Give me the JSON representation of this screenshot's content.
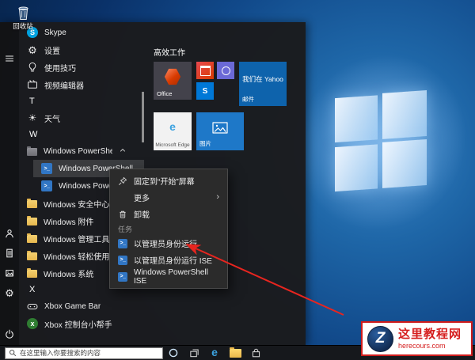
{
  "desktop": {
    "recycle_bin": {
      "label": "回收站",
      "icon": "recycle-bin"
    }
  },
  "start_menu": {
    "rail_icons": [
      "menu",
      "user",
      "documents",
      "pictures",
      "settings",
      "power"
    ],
    "app_list": [
      {
        "type": "app",
        "label": "Skype",
        "icon": "skype"
      },
      {
        "type": "app",
        "label": "设置",
        "icon": "settings-gear"
      },
      {
        "type": "app",
        "label": "使用技巧",
        "icon": "tips-bulb"
      },
      {
        "type": "app",
        "label": "视频编辑器",
        "icon": "video-editor"
      },
      {
        "type": "section",
        "label": "T"
      },
      {
        "type": "app",
        "label": "天气",
        "icon": "weather-sun"
      },
      {
        "type": "section",
        "label": "W"
      },
      {
        "type": "group",
        "label": "Windows PowerShell",
        "icon": "app-folder",
        "expanded": true
      },
      {
        "type": "app",
        "label": "Windows PowerShell",
        "icon": "powershell",
        "indent": true,
        "selected": true
      },
      {
        "type": "app",
        "label": "Windows PowerShell",
        "icon": "powershell",
        "indent": true
      },
      {
        "type": "folder",
        "label": "Windows 安全中心",
        "icon": "folder"
      },
      {
        "type": "folder",
        "label": "Windows 附件",
        "icon": "folder"
      },
      {
        "type": "folder",
        "label": "Windows 管理工具",
        "icon": "folder"
      },
      {
        "type": "folder",
        "label": "Windows 轻松使用",
        "icon": "folder"
      },
      {
        "type": "folder",
        "label": "Windows 系统",
        "icon": "folder"
      },
      {
        "type": "section",
        "label": "X"
      },
      {
        "type": "app",
        "label": "Xbox Game Bar",
        "icon": "xbox-gamebar"
      },
      {
        "type": "app",
        "label": "Xbox 控制台小帮手",
        "icon": "xbox-console"
      }
    ],
    "tiles": {
      "group_title": "高效工作",
      "office_label": "Office",
      "small_tiles": [
        {
          "icon": "calendar"
        },
        {
          "icon": "people"
        },
        {
          "icon": "skype"
        }
      ],
      "mail_promo": "我们在 Yahoo",
      "mail_label": "邮件",
      "edge_label": "Microsoft Edge",
      "photos_label": "图片"
    }
  },
  "context_menu": {
    "items": [
      {
        "label": "固定到“开始”屏幕",
        "icon": "pin"
      },
      {
        "label": "更多",
        "submenu": true
      },
      {
        "label": "卸载",
        "icon": "trash"
      },
      {
        "type": "section",
        "label": "任务"
      },
      {
        "label": "以管理员身份运行",
        "icon": "powershell"
      },
      {
        "label": "以管理员身份运行 ISE",
        "icon": "powershell-ise"
      },
      {
        "label": "Windows PowerShell ISE",
        "icon": "powershell-ise"
      }
    ]
  },
  "taskbar": {
    "search_placeholder": "在这里输入你要搜索的内容",
    "icons": [
      "cortana",
      "task-view",
      "edge",
      "file-explorer",
      "store"
    ]
  },
  "watermark": {
    "site_name": "这里教程网",
    "site_url": "herecours.com"
  },
  "colors": {
    "accent": "#0078d7",
    "arrow_red": "#e8251f",
    "watermark_red": "#d51e1e",
    "menu_bg": "#1b1b1d",
    "context_bg": "#2b2b2b"
  }
}
